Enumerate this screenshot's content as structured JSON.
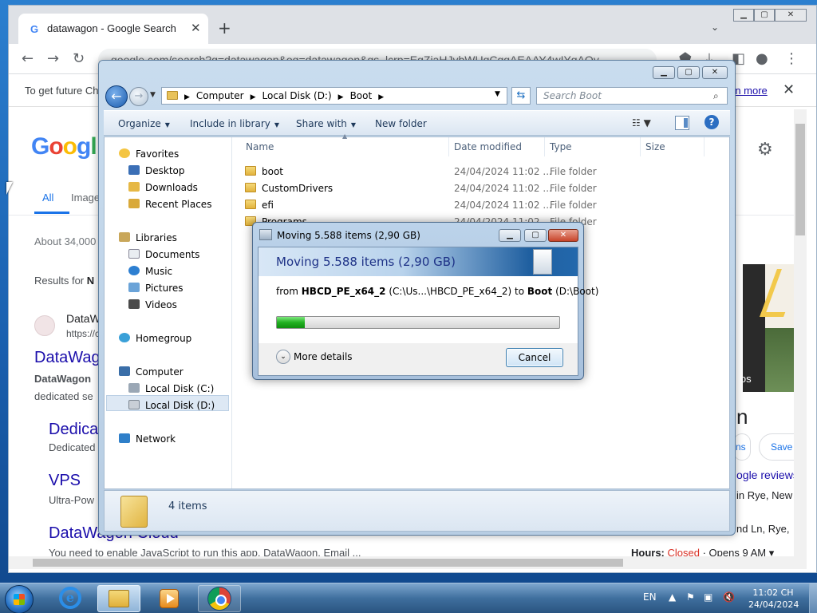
{
  "chrome": {
    "tab_title": "datawagon - Google Search",
    "url": "google.com/search?q=datawagon&oq=datawagon&gs_lcrp=EgZjaHJvbWUqCggAEAAY4wIYgAQy",
    "notice_text": "To get future Ch",
    "notice_link": "rn more",
    "google_logo": "Googl",
    "tab_all": "All",
    "tab_images": "Image",
    "about": "About 34,000",
    "results_for_prefix": "Results for",
    "results_for_bold": "N",
    "site_name": "DataW",
    "site_url": "https://c",
    "result_title": "DataWagon",
    "snippet_bold": "DataWagon",
    "snippet_line2": "dedicated se",
    "sub1_title": "Dedica",
    "sub1_desc": "Dedicated",
    "sub2_title": "VPS",
    "sub2_desc": "Ultra-Pow",
    "sub3_title": "DataWagon Cloud",
    "sub3_desc": "You need to enable JavaScript to run this app. DataWagon. Email ...",
    "kp_photos": "otos",
    "kp_heading": "n",
    "kp_btn1": "ns",
    "kp_btn2": "Save",
    "kp_reviews": "ogle reviews",
    "kp_addr1": "in Rye, New",
    "kp_addr2": "nd Ln, Rye,",
    "hours_label": "Hours:",
    "hours_status": "Closed",
    "hours_opens": "· Opens 9 AM ▾"
  },
  "explorer": {
    "breadcrumb": [
      "Computer",
      "Local Disk (D:)",
      "Boot"
    ],
    "search_placeholder": "Search Boot",
    "commands": {
      "organize": "Organize",
      "include": "Include in library",
      "share": "Share with",
      "new_folder": "New folder"
    },
    "nav": {
      "favorites": "Favorites",
      "desktop": "Desktop",
      "downloads": "Downloads",
      "recent": "Recent Places",
      "libraries": "Libraries",
      "documents": "Documents",
      "music": "Music",
      "pictures": "Pictures",
      "videos": "Videos",
      "homegroup": "Homegroup",
      "computer": "Computer",
      "disk_c": "Local Disk (C:)",
      "disk_d": "Local Disk (D:)",
      "network": "Network"
    },
    "columns": {
      "name": "Name",
      "date": "Date modified",
      "type": "Type",
      "size": "Size"
    },
    "files": [
      {
        "name": "boot",
        "date": "24/04/2024 11:02 ...",
        "type": "File folder"
      },
      {
        "name": "CustomDrivers",
        "date": "24/04/2024 11:02 ...",
        "type": "File folder"
      },
      {
        "name": "efi",
        "date": "24/04/2024 11:02 ...",
        "type": "File folder"
      },
      {
        "name": "Programs",
        "date": "24/04/2024 11:02 ...",
        "type": "File folder"
      }
    ],
    "status": "4 items"
  },
  "dialog": {
    "title": "Moving 5.588 items (2,90 GB)",
    "heading": "Moving 5.588 items (2,90 GB)",
    "from_label": "from",
    "source_name": "HBCD_PE_x64_2",
    "source_path": "(C:\\Us...\\HBCD_PE_x64_2)",
    "to_label": "to",
    "dest_name": "Boot",
    "dest_path": "(D:\\Boot)",
    "progress": 0.1,
    "more_details": "More details",
    "cancel": "Cancel"
  },
  "taskbar": {
    "lang": "EN",
    "time": "11:02 CH",
    "date": "24/04/2024"
  }
}
